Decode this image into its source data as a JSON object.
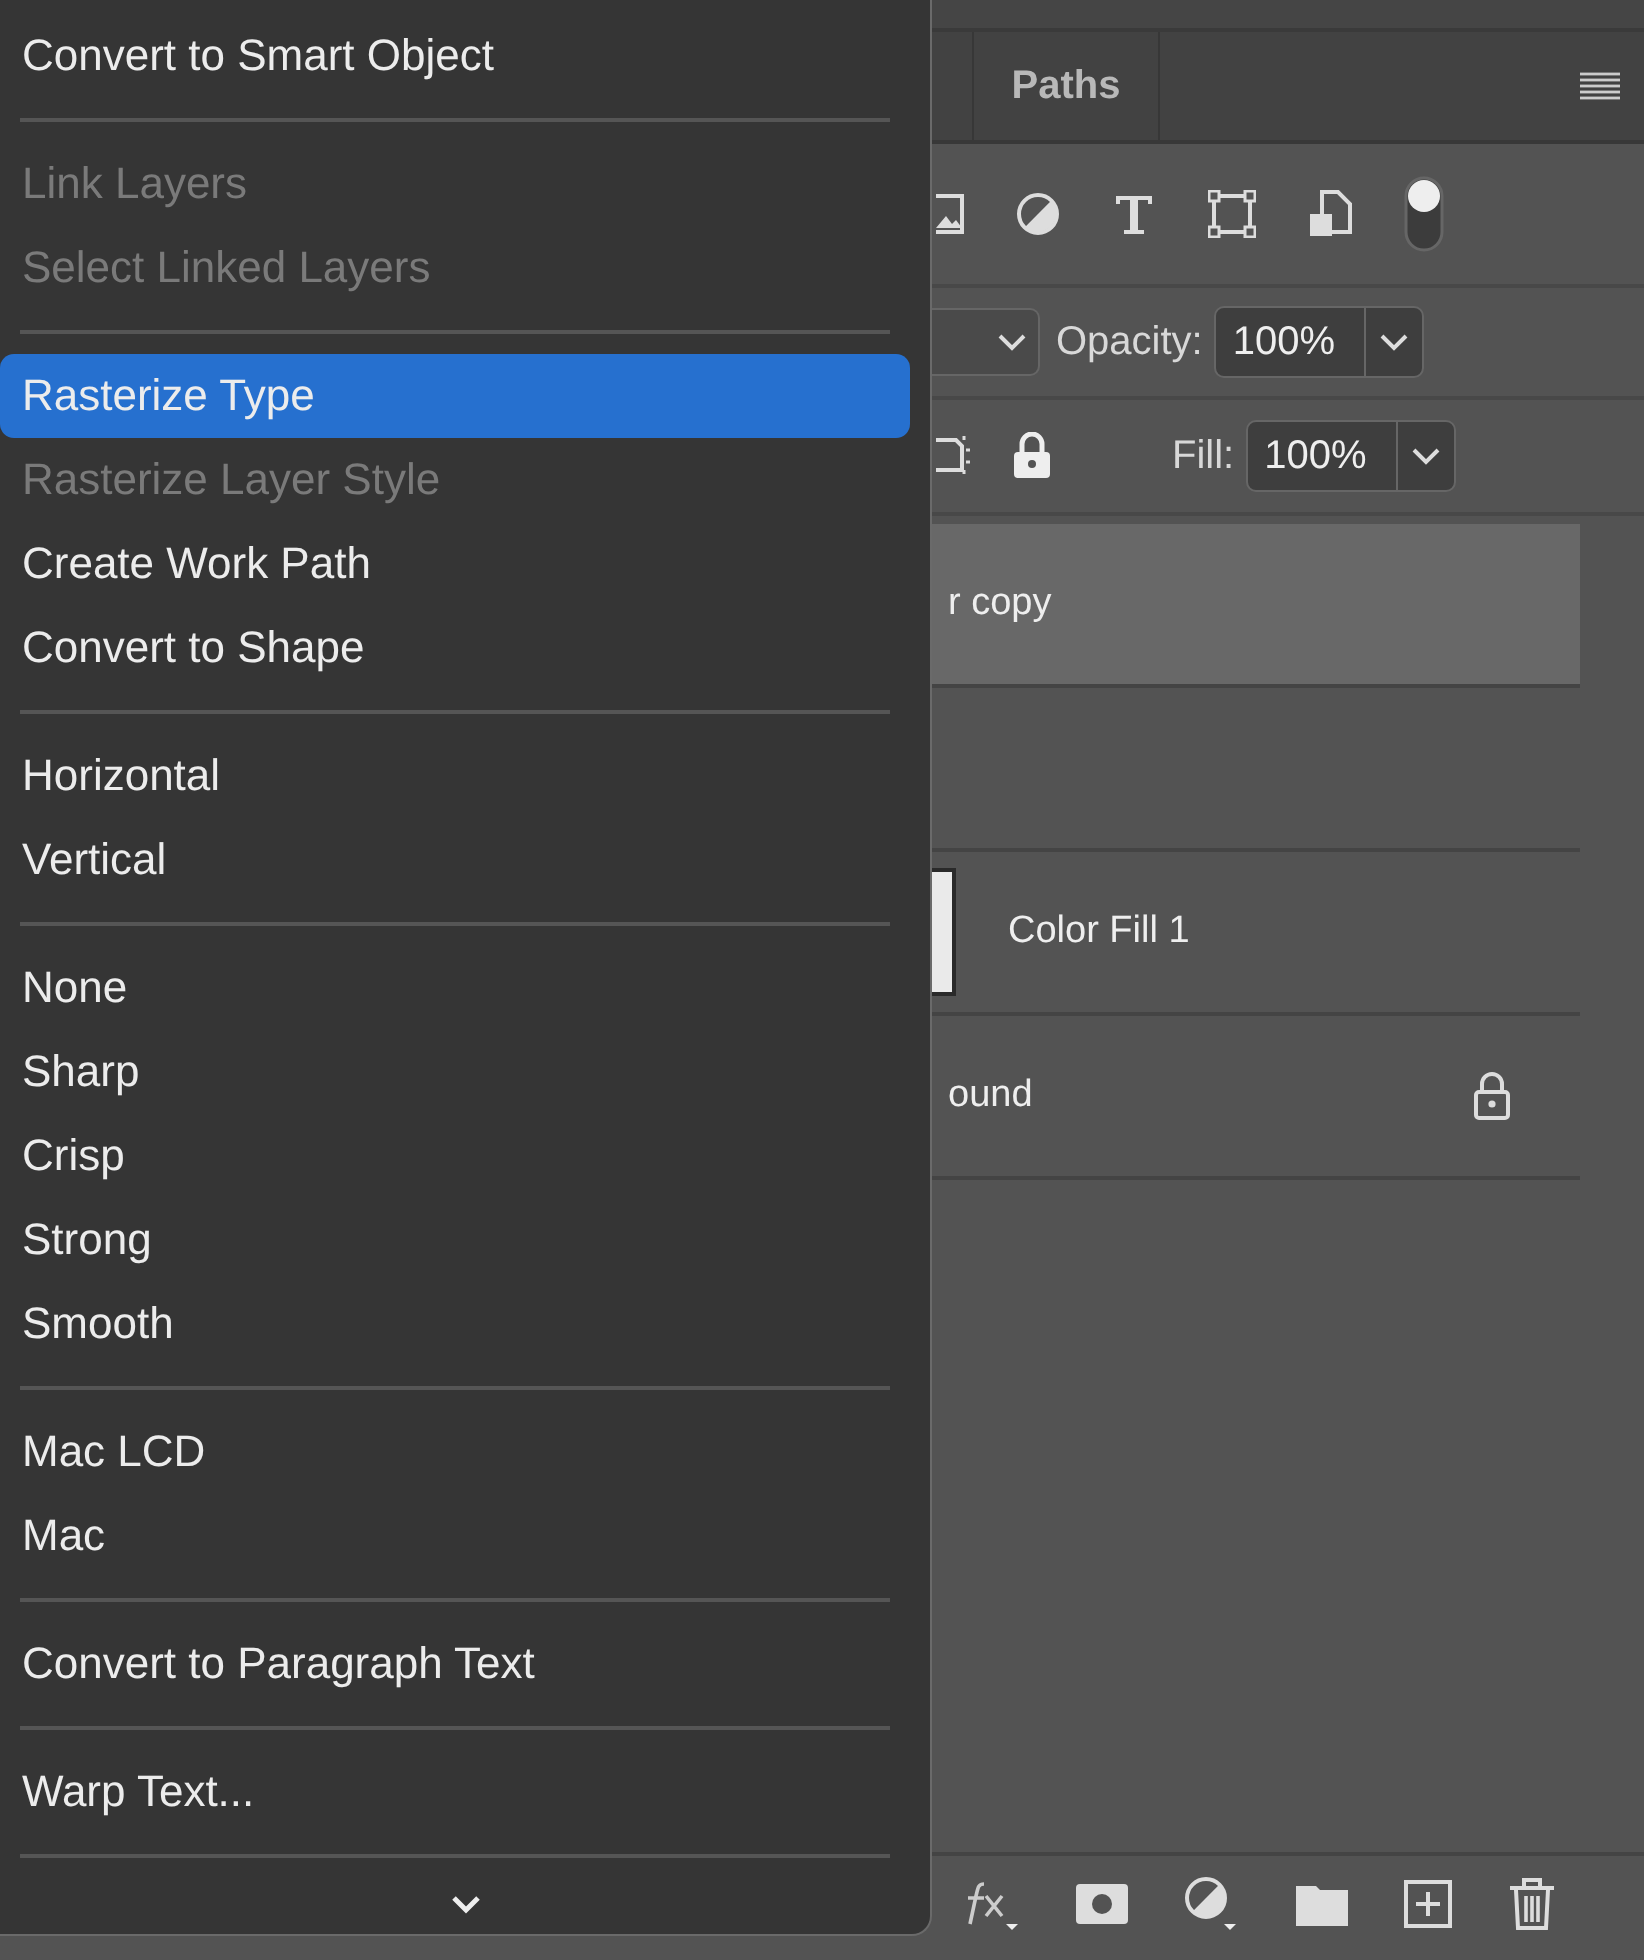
{
  "context_menu": {
    "groups": [
      {
        "items": [
          {
            "label": "Convert to Smart Object",
            "disabled": false,
            "selected": false
          }
        ]
      },
      {
        "items": [
          {
            "label": "Link Layers",
            "disabled": true,
            "selected": false
          },
          {
            "label": "Select Linked Layers",
            "disabled": true,
            "selected": false
          }
        ]
      },
      {
        "items": [
          {
            "label": "Rasterize Type",
            "disabled": false,
            "selected": true
          },
          {
            "label": "Rasterize Layer Style",
            "disabled": true,
            "selected": false
          },
          {
            "label": "Create Work Path",
            "disabled": false,
            "selected": false
          },
          {
            "label": "Convert to Shape",
            "disabled": false,
            "selected": false
          }
        ]
      },
      {
        "items": [
          {
            "label": "Horizontal",
            "disabled": false,
            "selected": false
          },
          {
            "label": "Vertical",
            "disabled": false,
            "selected": false
          }
        ]
      },
      {
        "items": [
          {
            "label": "None",
            "disabled": false,
            "selected": false
          },
          {
            "label": "Sharp",
            "disabled": false,
            "selected": false
          },
          {
            "label": "Crisp",
            "disabled": false,
            "selected": false
          },
          {
            "label": "Strong",
            "disabled": false,
            "selected": false
          },
          {
            "label": "Smooth",
            "disabled": false,
            "selected": false
          }
        ]
      },
      {
        "items": [
          {
            "label": "Mac LCD",
            "disabled": false,
            "selected": false
          },
          {
            "label": "Mac",
            "disabled": false,
            "selected": false
          }
        ]
      },
      {
        "items": [
          {
            "label": "Convert to Paragraph Text",
            "disabled": false,
            "selected": false
          }
        ]
      },
      {
        "items": [
          {
            "label": "Warp Text...",
            "disabled": false,
            "selected": false
          }
        ]
      }
    ]
  },
  "panel": {
    "tabs": [
      {
        "label": "Paths",
        "selected": false
      }
    ],
    "filter_toggle": {
      "on": true
    },
    "opacity": {
      "label": "Opacity:",
      "value": "100%"
    },
    "fill": {
      "label": "Fill:",
      "value": "100%"
    },
    "layers": [
      {
        "name": "r copy",
        "kind": "text",
        "selected": true,
        "locked": false
      },
      {
        "kind": "text",
        "selected": false,
        "locked": false
      },
      {
        "name": "Color Fill 1",
        "kind": "fill",
        "selected": false,
        "locked": false
      },
      {
        "name": "ound",
        "kind": "text",
        "selected": false,
        "locked": true
      }
    ]
  }
}
